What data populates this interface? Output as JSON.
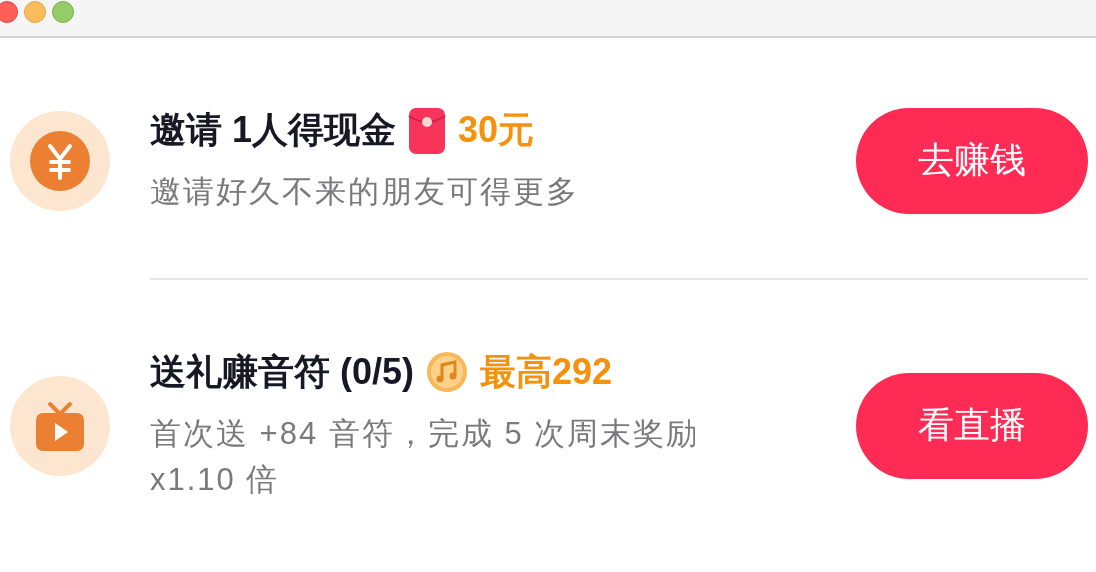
{
  "tasks": [
    {
      "kind": "cash",
      "title": "邀请 1人得现金",
      "reward": {
        "kind": "red-packet",
        "amount": "30元"
      },
      "description": "邀请好久不来的朋友可得更多",
      "button": "去赚钱"
    },
    {
      "kind": "live",
      "title": "送礼赚音符 (0/5)",
      "reward": {
        "kind": "coin",
        "amount": "最高292"
      },
      "description": "首次送 +84 音符，完成 5 次周末奖励 x1.10 倍",
      "button": "看直播"
    }
  ]
}
